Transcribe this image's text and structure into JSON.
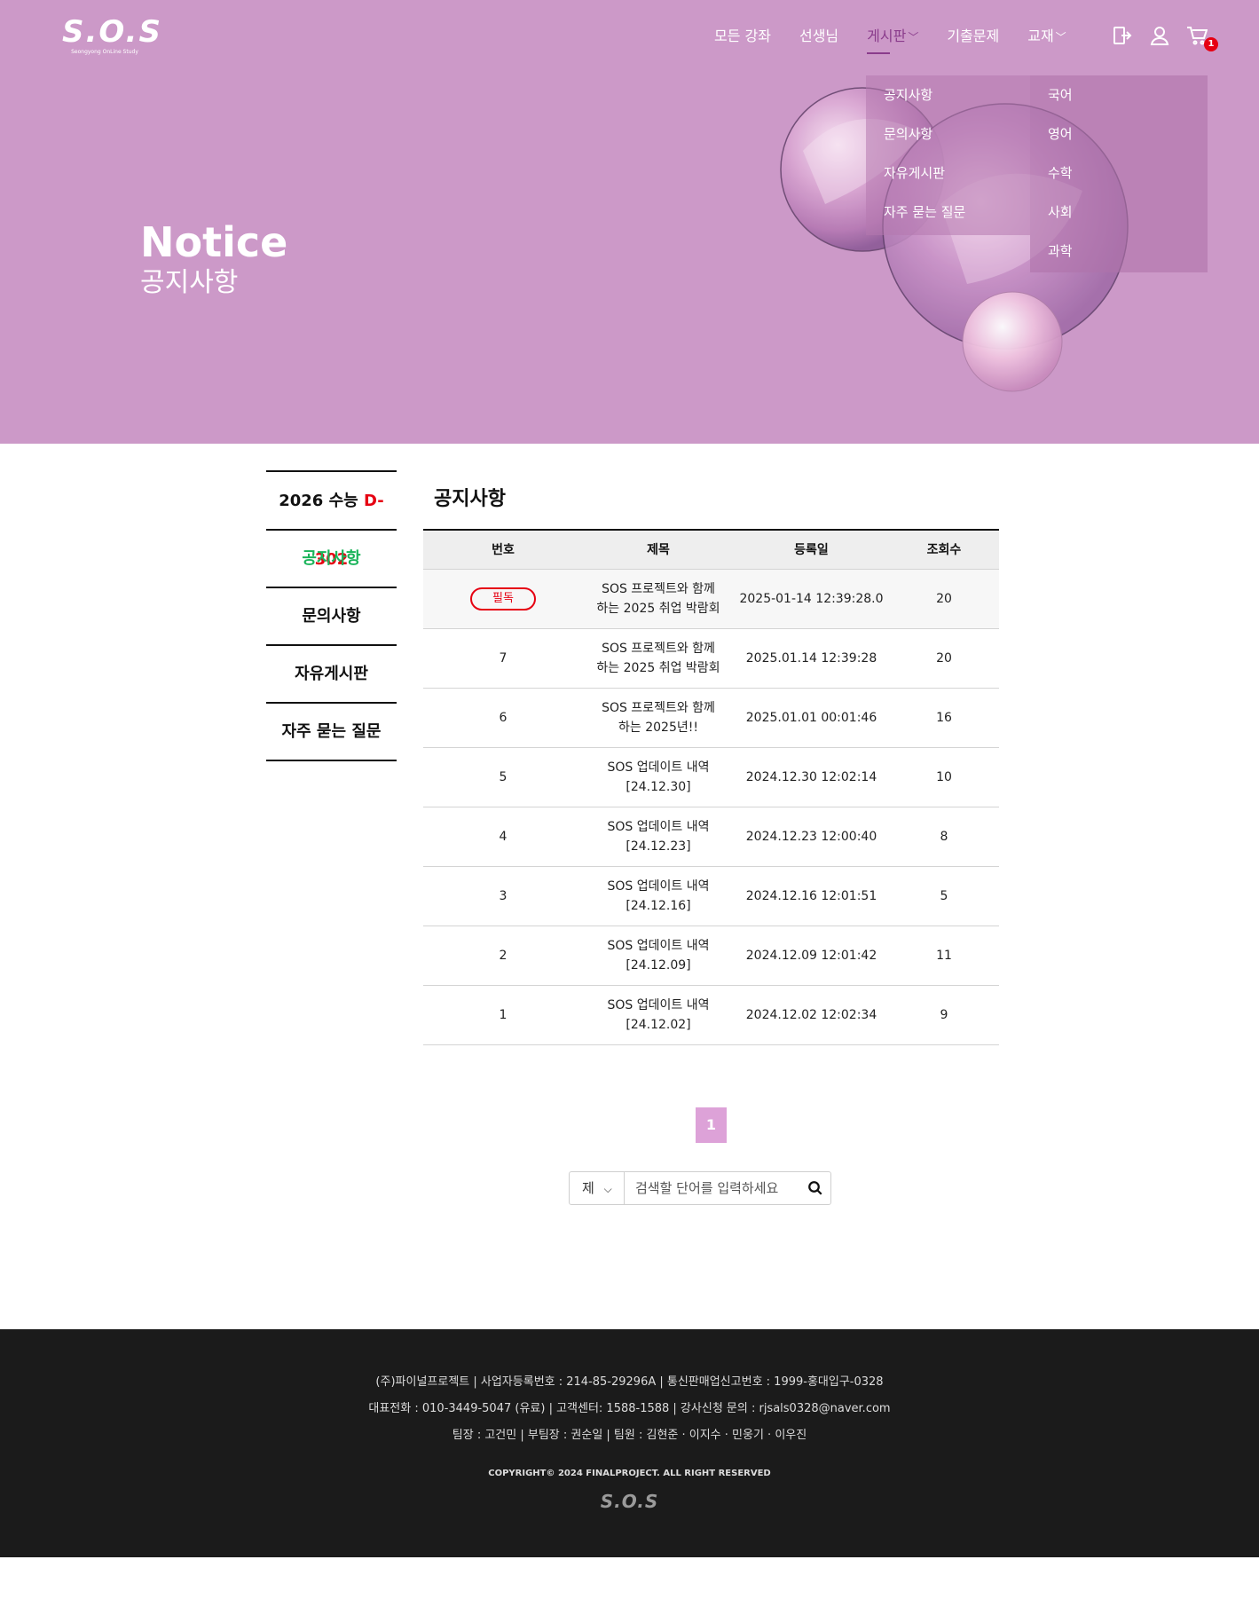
{
  "header": {
    "logo_text": "S.O.S",
    "logo_sub": "Seongyong OnLine Study",
    "nav": [
      {
        "label": "모든 강좌"
      },
      {
        "label": "선생님"
      },
      {
        "label": "게시판"
      },
      {
        "label": "기출문제"
      },
      {
        "label": "교재"
      }
    ],
    "cart_count": "1"
  },
  "board_menu": [
    "공지사항",
    "문의사항",
    "자유게시판",
    "자주 묻는 질문"
  ],
  "book_menu": [
    "국어",
    "영어",
    "수학",
    "사회",
    "과학"
  ],
  "hero": {
    "title_en": "Notice",
    "title_ko": "공지사항"
  },
  "sidebar": {
    "dday_label": "2026 수능",
    "dday_value": "D-302",
    "items": [
      "공지사항",
      "문의사항",
      "자유게시판",
      "자주 묻는 질문"
    ]
  },
  "content": {
    "heading": "공지사항",
    "columns": [
      "번호",
      "제목",
      "등록일",
      "조회수"
    ],
    "rows": [
      {
        "no": "필독",
        "title1": "SOS 프로젝트와 함께",
        "title2": "하는 2025 취업 박람회",
        "date": "2025-01-14 12:39:28.0",
        "views": "20"
      },
      {
        "no": "7",
        "title1": "SOS 프로젝트와 함께",
        "title2": "하는 2025 취업 박람회",
        "date": "2025.01.14 12:39:28",
        "views": "20"
      },
      {
        "no": "6",
        "title1": "SOS 프로젝트와 함께",
        "title2": "하는 2025년!!",
        "date": "2025.01.01 00:01:46",
        "views": "16"
      },
      {
        "no": "5",
        "title1": "SOS 업데이트 내역",
        "title2": "[24.12.30]",
        "date": "2024.12.30 12:02:14",
        "views": "10"
      },
      {
        "no": "4",
        "title1": "SOS 업데이트 내역",
        "title2": "[24.12.23]",
        "date": "2024.12.23 12:00:40",
        "views": "8"
      },
      {
        "no": "3",
        "title1": "SOS 업데이트 내역",
        "title2": "[24.12.16]",
        "date": "2024.12.16 12:01:51",
        "views": "5"
      },
      {
        "no": "2",
        "title1": "SOS 업데이트 내역",
        "title2": "[24.12.09]",
        "date": "2024.12.09 12:01:42",
        "views": "11"
      },
      {
        "no": "1",
        "title1": "SOS 업데이트 내역",
        "title2": "[24.12.02]",
        "date": "2024.12.02 12:02:34",
        "views": "9"
      }
    ]
  },
  "pagination": {
    "current": "1"
  },
  "search": {
    "select_value": "제",
    "placeholder": "검색할 단어를 입력하세요"
  },
  "footer": {
    "line1": "(주)파이널프로젝트 | 사업자등록번호 : 214-85-29296A | 통신판매업신고번호 : 1999-홍대입구-0328",
    "line2": "대표전화 : 010-3449-5047 (유료) | 고객센터: 1588-1588 | 강사신청 문의 : rjsals0328@naver.com",
    "line3": "팀장 : 고건민  |  부팀장 : 권순일  |  팀원 : 김현준 · 이지수 · 민웅기 · 이우진",
    "copyright": "COPYRIGHT© 2024 FINALPROJECT. ALL RIGHT RESERVED",
    "logo_text": "S.O.S"
  },
  "colors": {
    "hero_bg": "#cc99c8",
    "active_nav": "#8a3c8c",
    "active_side": "#1ab45a",
    "accent_red": "#e60012",
    "paging_bg": "#dda2d8",
    "footer_bg": "#1b1b1b"
  }
}
